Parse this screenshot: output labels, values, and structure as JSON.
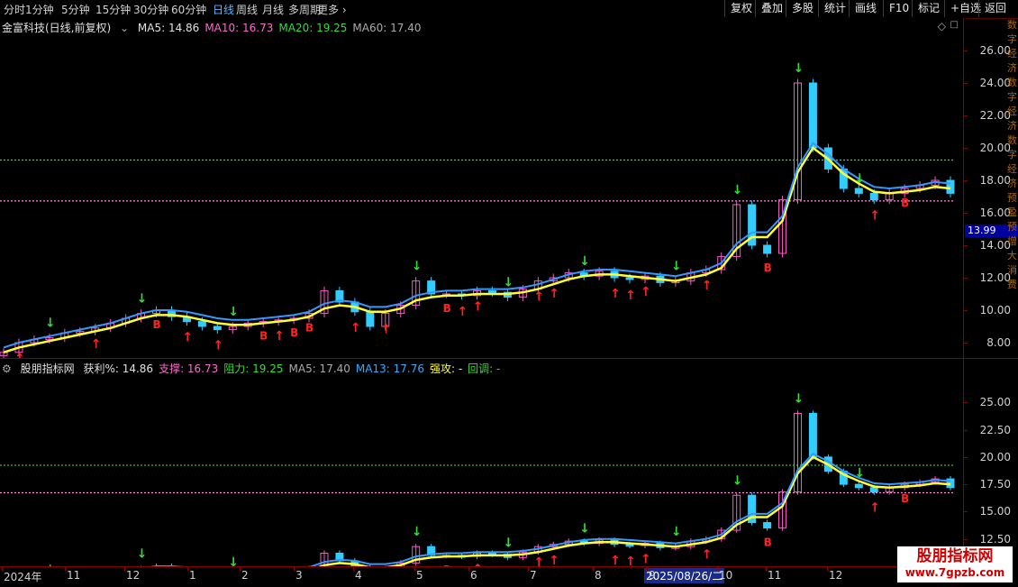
{
  "toolbar": {
    "periods": [
      "分时",
      "1分钟",
      "5分钟",
      "15分钟",
      "30分钟",
      "60分钟",
      "日线",
      "周线",
      "月线",
      "多周期",
      "更多"
    ],
    "active_index": 6,
    "right_buttons": [
      "复权",
      "叠加",
      "多股",
      "统计",
      "画线",
      "F10",
      "标记",
      "+自选",
      "返回"
    ]
  },
  "main_chart": {
    "title": "金富科技(日线,前复权)",
    "ma": [
      {
        "label": "MA5: 14.86",
        "color": "#e0e0e0"
      },
      {
        "label": "MA10: 16.73",
        "color": "#ff66cc"
      },
      {
        "label": "MA20: 19.25",
        "color": "#33dd33"
      },
      {
        "label": "MA60: 17.40",
        "color": "#aaaaaa"
      }
    ],
    "price_badge": "13.99"
  },
  "sub_chart": {
    "title": "股朋指标网",
    "items": [
      {
        "label": "获利%: 14.86",
        "color": "#e0e0e0"
      },
      {
        "label": "支撑: 16.73",
        "color": "#ff66cc"
      },
      {
        "label": "阻力: 19.25",
        "color": "#33dd33"
      },
      {
        "label": "MA5: 17.40",
        "color": "#aaaaaa"
      },
      {
        "label": "MA13: 17.76",
        "color": "#33aaff"
      },
      {
        "label": "强攻: -",
        "color": "#ffff33"
      },
      {
        "label": "回调: -",
        "color": "#33dd33"
      }
    ]
  },
  "x_axis": {
    "labels": [
      "2024年",
      "11",
      "12",
      "1",
      "2",
      "3",
      "4",
      "5",
      "6",
      "7",
      "8",
      "9",
      "10",
      "11",
      "12"
    ],
    "cursor_date": "2025/08/26/二"
  },
  "watermark": {
    "name": "股朋指标网",
    "url": "www.7gpzb.com"
  },
  "side_text": "数字经济数字经济数字经济预盈预增大消费",
  "chart_data": [
    {
      "type": "line",
      "title": "金富科技(日线,前复权)",
      "ylim": [
        7,
        27
      ],
      "y_ticks": [
        8.0,
        10.0,
        12.0,
        14.0,
        16.0,
        18.0,
        20.0,
        22.0,
        24.0,
        26.0
      ],
      "support_level": 16.73,
      "resistance_level": 19.25,
      "series": [
        {
          "name": "收盘",
          "values": [
            7.4,
            8.0,
            8.2,
            8.3,
            8.6,
            8.7,
            8.9,
            9.2,
            9.5,
            9.8,
            10.0,
            9.6,
            9.3,
            9.0,
            8.8,
            9.0,
            9.2,
            9.3,
            9.4,
            9.5,
            9.8,
            11.2,
            10.5,
            9.9,
            9.0,
            9.8,
            10.3,
            11.8,
            11.0,
            11.0,
            10.9,
            11.2,
            11.1,
            10.8,
            11.3,
            11.8,
            12.0,
            12.3,
            12.1,
            12.4,
            12.0,
            11.9,
            12.1,
            11.7,
            11.8,
            12.3,
            12.5,
            13.3,
            16.5,
            14.0,
            13.5,
            16.8,
            24.0,
            20.0,
            18.7,
            17.5,
            17.2,
            16.8,
            17.2,
            17.5,
            17.7,
            18.0,
            17.2
          ]
        },
        {
          "name": "MA",
          "values": [
            7.4,
            7.7,
            7.9,
            8.1,
            8.3,
            8.5,
            8.7,
            8.9,
            9.2,
            9.5,
            9.7,
            9.7,
            9.6,
            9.4,
            9.2,
            9.1,
            9.1,
            9.2,
            9.3,
            9.4,
            9.6,
            10.1,
            10.3,
            10.2,
            9.9,
            9.9,
            10.1,
            10.6,
            10.8,
            10.9,
            10.9,
            11.0,
            11.0,
            11.0,
            11.1,
            11.3,
            11.6,
            11.9,
            12.1,
            12.2,
            12.2,
            12.1,
            12.0,
            11.9,
            11.8,
            12.0,
            12.2,
            12.6,
            13.8,
            14.5,
            14.5,
            15.5,
            18.5,
            20.0,
            19.3,
            18.4,
            17.8,
            17.3,
            17.2,
            17.3,
            17.4,
            17.6,
            17.5
          ]
        }
      ]
    },
    {
      "type": "line",
      "title": "股朋指标网",
      "ylim": [
        10,
        27.5
      ],
      "y_ticks": [
        12.5,
        15.0,
        17.5,
        20.0,
        22.5,
        25.0
      ],
      "support_level": 16.73,
      "resistance_level": 19.25
    }
  ]
}
